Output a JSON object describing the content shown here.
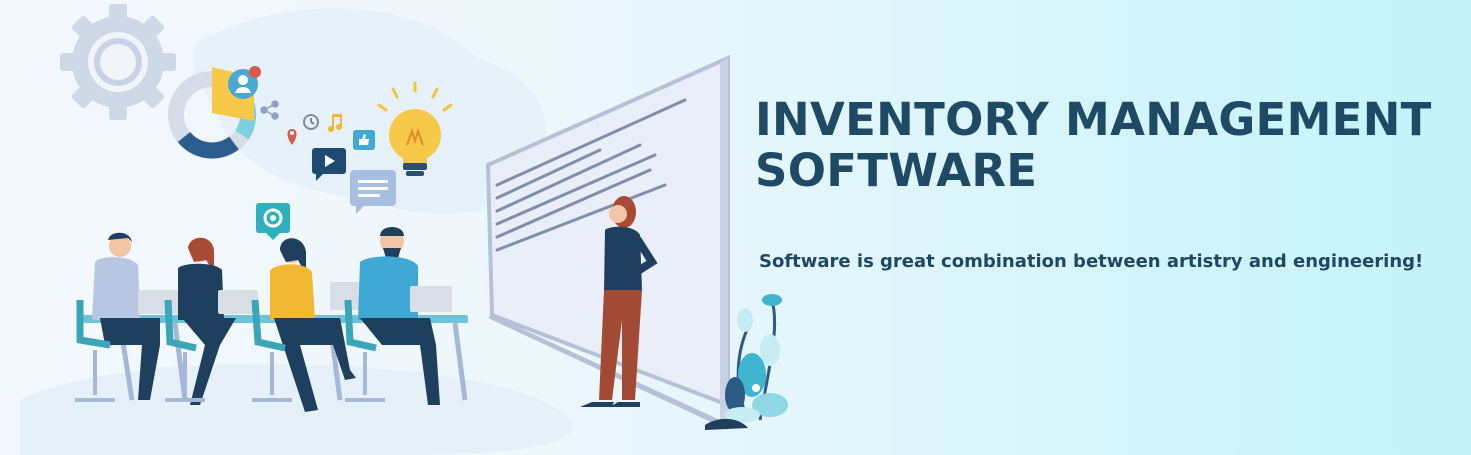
{
  "headline": {
    "line1": "INVENTORY MANAGEMENT",
    "line2": "SOFTWARE"
  },
  "tagline": "Software is great combination between artistry and engineering!",
  "colors": {
    "headline": "#1f4a66",
    "accent_teal": "#3fb5cf",
    "accent_yellow": "#f7c948",
    "background_right": "#c3f3fb"
  },
  "icons": [
    "gear-icon",
    "pie-chart-icon",
    "user-icon",
    "share-icon",
    "location-pin-icon",
    "clock-icon",
    "music-note-icon",
    "thumbs-up-icon",
    "play-icon",
    "chat-icon",
    "lightbulb-icon",
    "settings-icon",
    "plant-icon"
  ]
}
